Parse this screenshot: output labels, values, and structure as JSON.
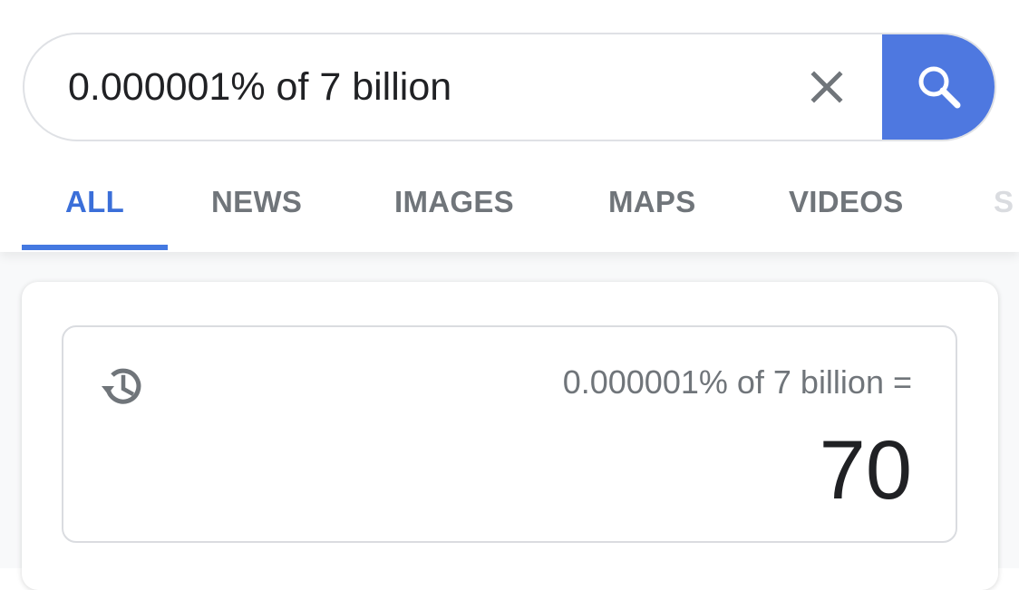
{
  "search": {
    "query": "0.000001% of 7 billion",
    "clear_icon": "close-icon",
    "submit_icon": "search-icon",
    "accent_color": "#4e78e0"
  },
  "tabs": [
    {
      "label": "ALL",
      "active": true
    },
    {
      "label": "NEWS",
      "active": false
    },
    {
      "label": "IMAGES",
      "active": false
    },
    {
      "label": "MAPS",
      "active": false
    },
    {
      "label": "VIDEOS",
      "active": false
    },
    {
      "label": "S",
      "active": false
    }
  ],
  "calculator": {
    "history_icon": "history-icon",
    "expression": "0.000001% of 7 billion =",
    "result": "70"
  }
}
